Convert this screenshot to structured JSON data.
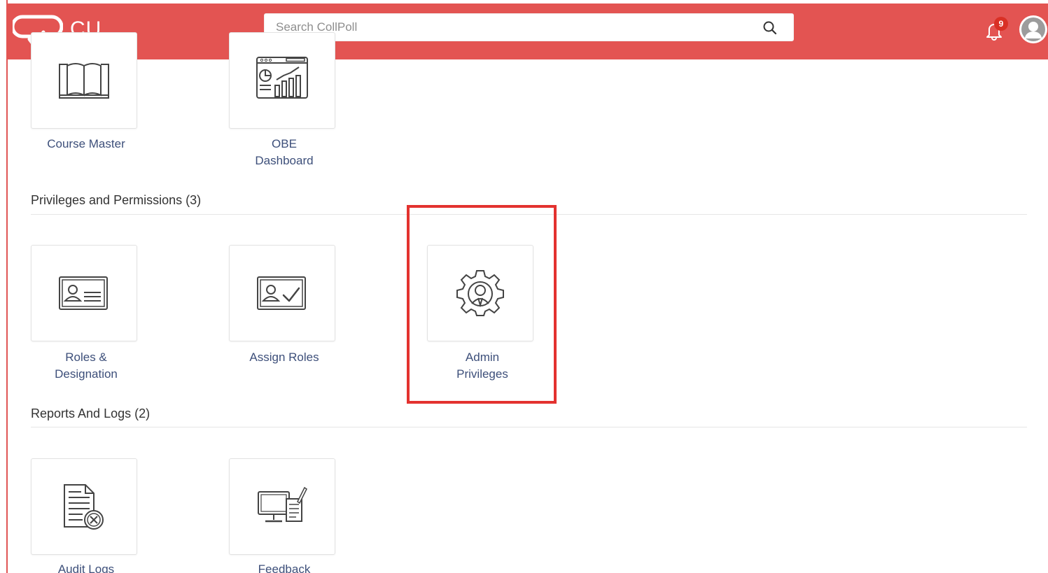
{
  "header": {
    "logo_text": "CU",
    "search_placeholder": "Search CollPoll",
    "notification_count": "9",
    "colors": {
      "bar": "#e35452",
      "badge": "#d93025",
      "highlight": "#e3322f"
    }
  },
  "sections": {
    "top_tiles": [
      {
        "label": "Course Master",
        "icon": "book-icon"
      },
      {
        "label": "OBE\nDashboard",
        "icon": "dashboard-icon"
      }
    ],
    "privileges": {
      "title": "Privileges and Permissions (3)",
      "tiles": [
        {
          "label": "Roles &\nDesignation",
          "icon": "id-card-icon"
        },
        {
          "label": "Assign Roles",
          "icon": "assign-id-card-icon"
        },
        {
          "label": "Admin\nPrivileges",
          "icon": "admin-gear-icon"
        }
      ]
    },
    "reports": {
      "title": "Reports And Logs (2)",
      "tiles": [
        {
          "label": "Audit Logs",
          "icon": "audit-document-icon"
        },
        {
          "label": "Feedback",
          "icon": "feedback-monitor-icon"
        }
      ]
    }
  }
}
